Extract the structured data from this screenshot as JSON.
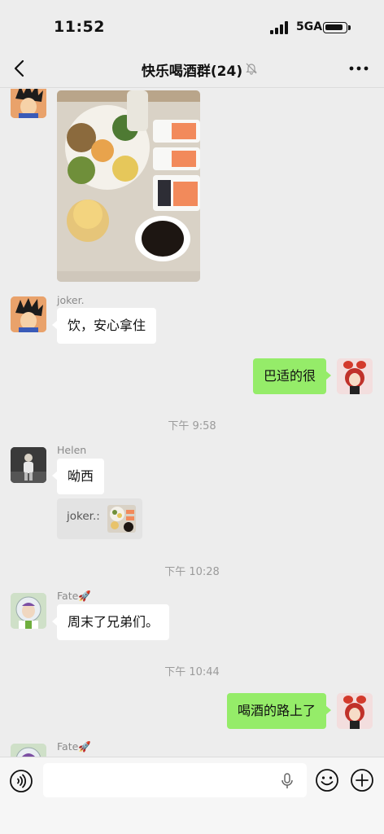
{
  "status": {
    "time": "11:52",
    "network": "5GA"
  },
  "nav": {
    "title": "快乐喝酒群(24)"
  },
  "messages": {
    "m1": {
      "sender": "joker.",
      "text": "饮，安心拿住"
    },
    "m2": {
      "text": "巴适的很"
    },
    "t1": "下午 9:58",
    "m3": {
      "sender": "Helen",
      "text": "呦西",
      "quote_label": "joker.:"
    },
    "t2": "下午 10:28",
    "m4": {
      "sender": "Fate🚀",
      "text": "周末了兄弟们。"
    },
    "t3": "下午 10:44",
    "m5": {
      "text": "喝酒的路上了"
    },
    "m6": {
      "sender": "Fate🚀"
    }
  },
  "input": {
    "value": ""
  },
  "colors": {
    "background": "#ededed",
    "bubble_self": "#95ec69",
    "bubble_other": "#ffffff",
    "timestamp": "#9b9b9b"
  }
}
